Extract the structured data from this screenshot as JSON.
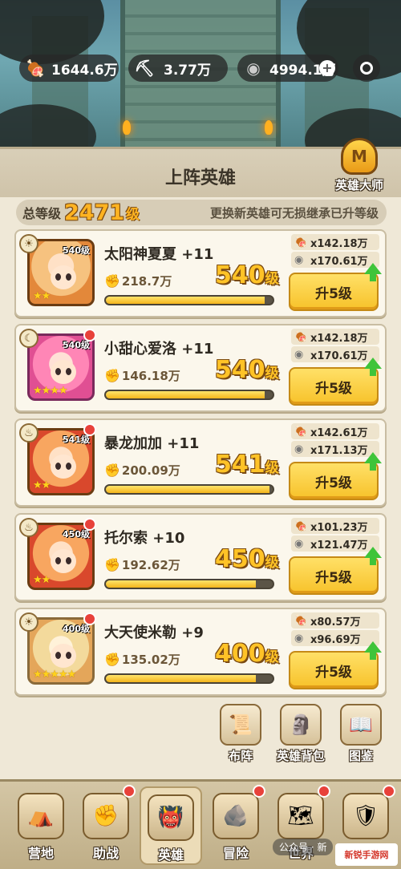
{
  "resources": [
    {
      "icon": "meat-icon",
      "value": "1644.6万"
    },
    {
      "icon": "ore-cart-icon",
      "value": "3.77万"
    },
    {
      "icon": "stone-coin-icon",
      "value": "4994.1万"
    }
  ],
  "panel": {
    "title": "上阵英雄",
    "master_label": "英雄大师",
    "total_label": "总等级",
    "total_value": "2471",
    "total_unit": "级",
    "hint": "更换新英雄可无损继承已升等级"
  },
  "heroes": [
    {
      "name": "太阳神夏夏 +11",
      "portrait_level": "540级",
      "power": "218.7万",
      "level": "540",
      "level_unit": "级",
      "cost_meat": "x142.18万",
      "cost_stone": "x170.61万",
      "upgrade": "升5级",
      "progress": 0.95,
      "stars": "★★",
      "element": "sun"
    },
    {
      "name": "小甜心爱洛 +11",
      "portrait_level": "540级",
      "power": "146.18万",
      "level": "540",
      "level_unit": "级",
      "cost_meat": "x142.18万",
      "cost_stone": "x170.61万",
      "upgrade": "升5级",
      "progress": 0.95,
      "stars": "★★★★",
      "element": "moon"
    },
    {
      "name": "暴龙加加 +11",
      "portrait_level": "541级",
      "power": "200.09万",
      "level": "541",
      "level_unit": "级",
      "cost_meat": "x142.61万",
      "cost_stone": "x171.13万",
      "upgrade": "升5级",
      "progress": 0.98,
      "stars": "★★",
      "element": "fire"
    },
    {
      "name": "托尔索 +10",
      "portrait_level": "450级",
      "power": "192.62万",
      "level": "450",
      "level_unit": "级",
      "cost_meat": "x101.23万",
      "cost_stone": "x121.47万",
      "upgrade": "升5级",
      "progress": 0.9,
      "stars": "★★",
      "element": "fire"
    },
    {
      "name": "大天使米勒 +9",
      "portrait_level": "400级",
      "power": "135.02万",
      "level": "400",
      "level_unit": "级",
      "cost_meat": "x80.57万",
      "cost_stone": "x96.69万",
      "upgrade": "升5级",
      "progress": 0.9,
      "stars": "★★★★★",
      "element": "sun"
    }
  ],
  "quick_buttons": [
    {
      "label": "布阵",
      "icon": "formation-scroll-icon"
    },
    {
      "label": "英雄背包",
      "icon": "hero-bag-icon"
    },
    {
      "label": "图鉴",
      "icon": "codex-icon"
    }
  ],
  "nav": [
    {
      "label": "营地",
      "icon": "camp-icon",
      "dot": false
    },
    {
      "label": "助战",
      "icon": "fist-icon",
      "dot": true
    },
    {
      "label": "英雄",
      "icon": "hero-mask-icon",
      "dot": false,
      "active": true
    },
    {
      "label": "冒险",
      "icon": "adventure-rock-icon",
      "dot": true
    },
    {
      "label": "世界",
      "icon": "world-map-icon",
      "dot": true
    },
    {
      "label": "部落",
      "icon": "tribe-shield-icon",
      "dot": true
    }
  ],
  "watermark": "公众号 · 新",
  "watermark_logo": "新锐手游网",
  "colors": {
    "accent": "#ffc327",
    "button": "#f7c22a",
    "badge": "#e8413a",
    "arrow": "#3fc43a"
  }
}
